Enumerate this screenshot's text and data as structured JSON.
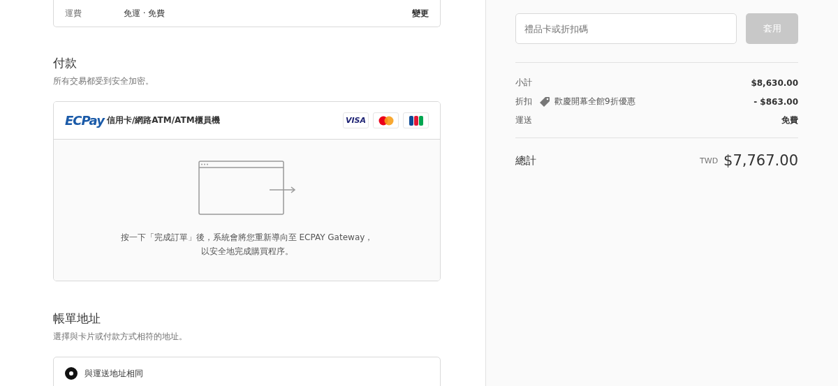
{
  "shipping_summary": {
    "label": "運費",
    "value": "免運 · 免費",
    "action": "變更"
  },
  "payment": {
    "title": "付款",
    "subtitle": "所有交易都受到安全加密。",
    "method": {
      "logo": "ECPay",
      "label": "信用卡/網路ATM/ATM櫃員機",
      "cards": [
        {
          "kind": "visa",
          "text": "VISA"
        },
        {
          "kind": "mastercard"
        },
        {
          "kind": "jcb"
        }
      ]
    },
    "redirect_note": [
      "按一下「完成訂單」後，系統會將您重新導向至 ECPAY Gateway，",
      "以安全地完成購買程序。"
    ]
  },
  "billing": {
    "title": "帳單地址",
    "subtitle": "選擇與卡片或付款方式相符的地址。",
    "options": [
      {
        "label": "與運送地址相同",
        "selected": true
      }
    ]
  },
  "discount": {
    "placeholder": "禮品卡或折扣碼",
    "button": "套用",
    "disabled": true
  },
  "summary": [
    {
      "label": "小計",
      "value": "$8,630.00"
    },
    {
      "label": "折扣",
      "tag": "歡慶開幕全館9折優惠",
      "value": "- $863.00"
    },
    {
      "label": "運送",
      "value": "免費"
    }
  ],
  "total": {
    "label": "總計",
    "currency": "TWD",
    "value": "$7,767.00"
  }
}
